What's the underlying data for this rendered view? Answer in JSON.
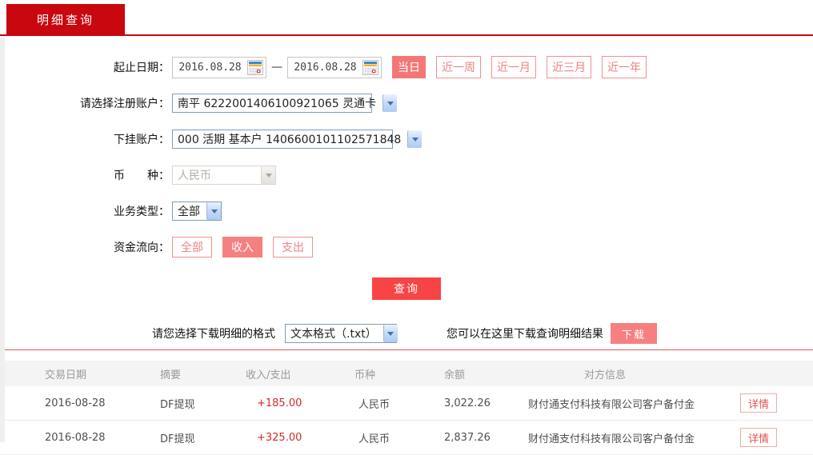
{
  "tab": {
    "label": "明细查询"
  },
  "form": {
    "date_range": {
      "label": "起止日期：",
      "start": "2016.08.28",
      "end": "2016.08.28",
      "separator": "—",
      "quick_buttons": [
        {
          "label": "当日",
          "active": true
        },
        {
          "label": "近一周",
          "active": false
        },
        {
          "label": "近一月",
          "active": false
        },
        {
          "label": "近三月",
          "active": false
        },
        {
          "label": "近一年",
          "active": false
        }
      ]
    },
    "register_account": {
      "label": "请选择注册账户：",
      "value": "南平 6222001406100921065 灵通卡"
    },
    "sub_account": {
      "label": "下挂账户：",
      "value": "000 活期 基本户 1406600101102571848"
    },
    "currency": {
      "label": "币　　种：",
      "value": "人民币",
      "disabled": true
    },
    "business_type": {
      "label": "业务类型：",
      "value": "全部"
    },
    "fund_flow": {
      "label": "资金流向：",
      "options": [
        {
          "label": "全部",
          "active": false
        },
        {
          "label": "收入",
          "active": true
        },
        {
          "label": "支出",
          "active": false
        }
      ]
    },
    "query_button": "查询"
  },
  "download": {
    "format_label": "请您选择下载明细的格式",
    "format_value": "文本格式（.txt）",
    "hint": "您可以在这里下载查询明细结果",
    "button": "下载"
  },
  "table": {
    "headers": {
      "date": "交易日期",
      "summary": "摘要",
      "amount": "收入/支出",
      "currency": "币种",
      "balance": "余额",
      "counterparty": "对方信息"
    },
    "rows": [
      {
        "date": "2016-08-28",
        "summary": "DF提现",
        "amount": "+185.00",
        "currency": "人民币",
        "balance": "3,022.26",
        "counterparty": "财付通支付科技有限公司客户备付金",
        "action": "详情"
      },
      {
        "date": "2016-08-28",
        "summary": "DF提现",
        "amount": "+325.00",
        "currency": "人民币",
        "balance": "2,837.26",
        "counterparty": "财付通支付科技有限公司客户备付金",
        "action": "详情"
      }
    ]
  },
  "colors": {
    "brand_red": "#c9070f",
    "query_button_red": "#f84444",
    "salmon_fill": "#f58080",
    "salmon_border": "#f09090",
    "amount_red": "#d02b2b",
    "divider_red": "#dd5a5a"
  }
}
